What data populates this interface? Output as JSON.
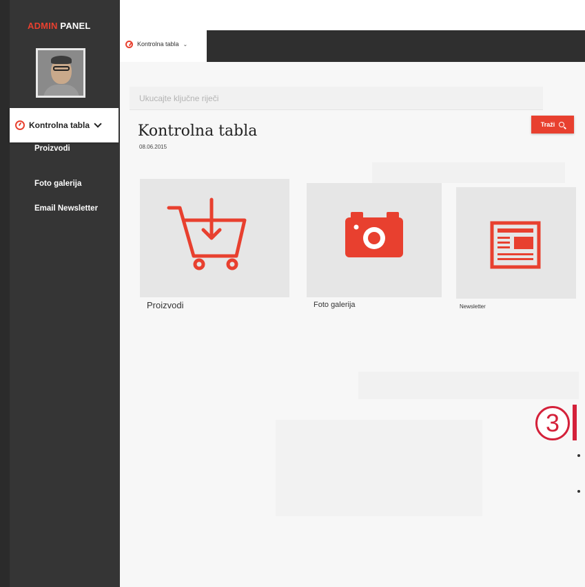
{
  "sidebar": {
    "brand_accent": "ADMIN",
    "brand_rest": "PANEL",
    "active_item": "Kontrolna tabla",
    "items": [
      {
        "label": "Proizvodi"
      },
      {
        "label": "Foto galerija"
      },
      {
        "label": "Email Newsletter"
      }
    ]
  },
  "tab": {
    "label": "Kontrolna tabla",
    "caret": "⌄"
  },
  "search": {
    "placeholder": "Ukucajte ključne riječi",
    "button_label": "Traži"
  },
  "page": {
    "title": "Kontrolna tabla",
    "date": "08.06.2015"
  },
  "tiles": [
    {
      "label": "Proizvodi",
      "icon": "cart-icon"
    },
    {
      "label": "Foto galerija",
      "icon": "camera-icon"
    },
    {
      "label": "Newsletter",
      "icon": "newsletter-icon"
    }
  ],
  "overlay": {
    "step_number": "3"
  },
  "colors": {
    "accent": "#e8402f",
    "sidebar": "#353535",
    "step": "#d4213a"
  }
}
